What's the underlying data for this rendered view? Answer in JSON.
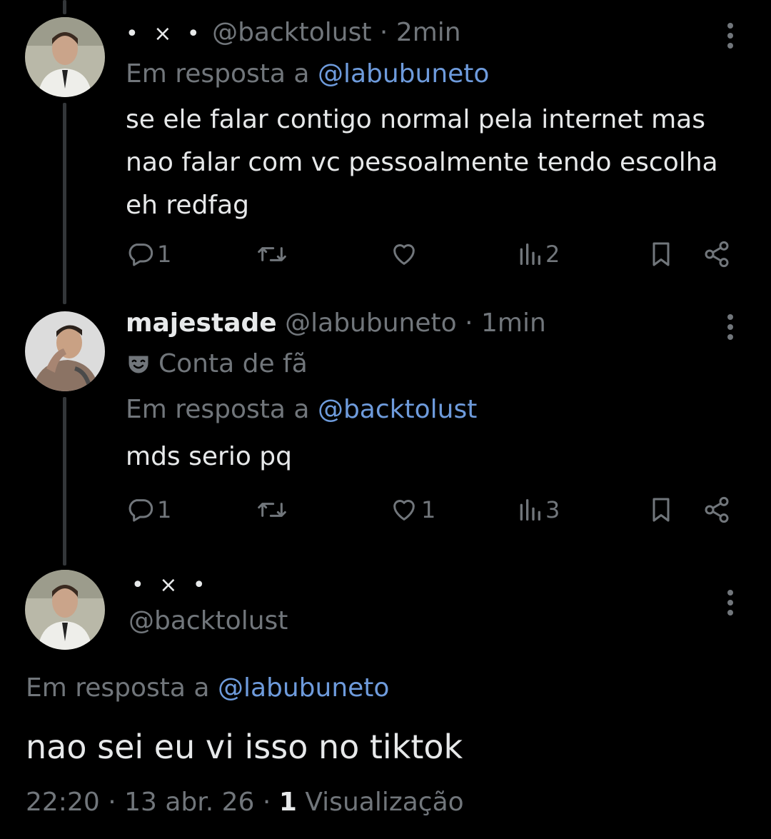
{
  "tweets": [
    {
      "display_name": "• × •",
      "handle": "@backtolust",
      "separator": "·",
      "time": "2min",
      "reply_prefix": "Em resposta a",
      "reply_to": "@labubuneto",
      "text": "se ele falar contigo normal pela internet mas nao falar com vc pessoalmente tendo escolha eh redfag",
      "actions": {
        "replies": "1",
        "retweets": "",
        "likes": "",
        "views": "2"
      }
    },
    {
      "display_name": "majestade",
      "handle": "@labubuneto",
      "separator": "·",
      "time": "1min",
      "badge_label": "Conta de fã",
      "reply_prefix": "Em resposta a",
      "reply_to": "@backtolust",
      "text": "mds serio pq",
      "actions": {
        "replies": "1",
        "retweets": "",
        "likes": "1",
        "views": "3"
      }
    }
  ],
  "main_tweet": {
    "display_name": "• × •",
    "handle": "@backtolust",
    "reply_prefix": "Em resposta a",
    "reply_to": "@labubuneto",
    "text": "nao sei eu vi isso no tiktok",
    "time": "22:20",
    "date": "13 abr. 26",
    "dot": "·",
    "views_count": "1",
    "views_label": "Visualização"
  },
  "colors": {
    "background": "#000000",
    "text": "#e7e9ea",
    "muted": "#71767b",
    "link": "#6e9bdc"
  },
  "icons": [
    "reply-icon",
    "retweet-icon",
    "like-icon",
    "views-icon",
    "bookmark-icon",
    "share-icon",
    "more-icon",
    "mask-icon"
  ]
}
